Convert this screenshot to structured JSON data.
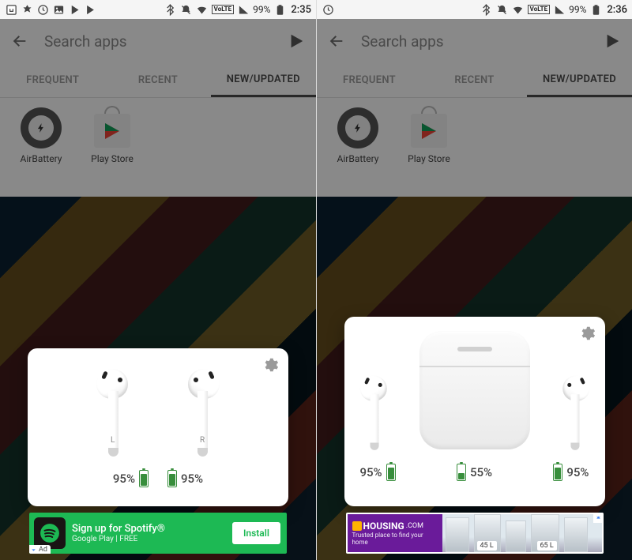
{
  "left": {
    "status": {
      "battery": "99%",
      "time": "2:35"
    },
    "search": {
      "placeholder": "Search apps"
    },
    "tabs": {
      "frequent": "FREQUENT",
      "recent": "RECENT",
      "new": "NEW/UPDATED"
    },
    "apps": {
      "airbattery": "AirBattery",
      "playstore": "Play Store"
    },
    "popup": {
      "left_pod_letter": "L",
      "right_pod_letter": "R",
      "left_pct": "95%",
      "right_pct": "95%"
    },
    "ad": {
      "title": "Sign up for Spotify®",
      "subtitle": "Google Play   |   FREE",
      "cta": "Install",
      "badge": "Ad"
    }
  },
  "right": {
    "status": {
      "battery": "99%",
      "time": "2:36"
    },
    "search": {
      "placeholder": "Search apps"
    },
    "tabs": {
      "frequent": "FREQUENT",
      "recent": "RECENT",
      "new": "NEW/UPDATED"
    },
    "apps": {
      "airbattery": "AirBattery",
      "playstore": "Play Store"
    },
    "popup": {
      "left_pct": "95%",
      "case_pct": "55%",
      "right_pct": "95%"
    },
    "ad": {
      "brand": "HOUSING",
      "brand_suffix": ".COM",
      "tagline": "Trusted place to find your home",
      "tag1": "45 L",
      "tag2": "65 L"
    }
  }
}
